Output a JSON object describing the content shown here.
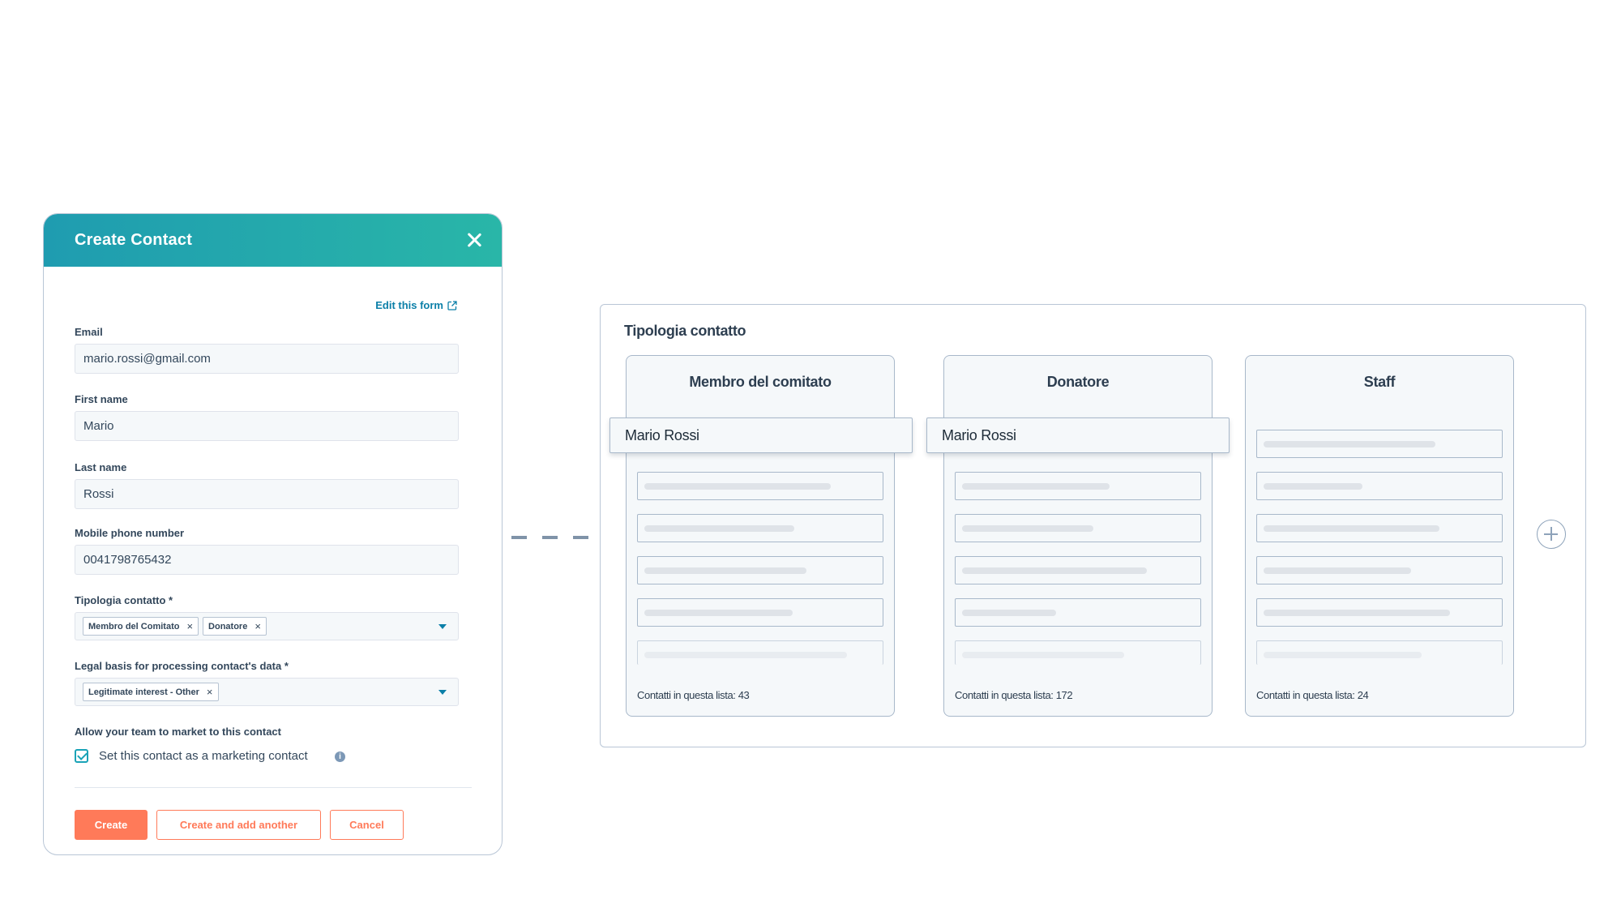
{
  "modal": {
    "title": "Create Contact",
    "edit_link": "Edit this form",
    "fields": {
      "email": {
        "label": "Email",
        "value": "mario.rossi@gmail.com"
      },
      "first_name": {
        "label": "First name",
        "value": "Mario"
      },
      "last_name": {
        "label": "Last name",
        "value": "Rossi"
      },
      "phone": {
        "label": "Mobile phone number",
        "value": "0041798765432"
      },
      "tipologia": {
        "label": "Tipologia contatto *",
        "tags": [
          "Membro del Comitato",
          "Donatore"
        ]
      },
      "legal": {
        "label": "Legal basis for processing contact's data *",
        "tags": [
          "Legitimate interest - Other"
        ]
      }
    },
    "marketing": {
      "label": "Allow your team to market to this contact",
      "checkbox_label": "Set this contact as a marketing contact",
      "checked": true
    },
    "buttons": {
      "create": "Create",
      "create_another": "Create and add another",
      "cancel": "Cancel"
    }
  },
  "pipeline": {
    "title": "Tipologia contatto",
    "columns": [
      {
        "name": "Membro del comitato",
        "footer": "Contatti in questa lista: 43",
        "dragged_card": "Mario Rossi"
      },
      {
        "name": "Donatore",
        "footer": "Contatti in questa lista: 172",
        "dragged_card": "Mario Rossi"
      },
      {
        "name": "Staff",
        "footer": "Contatti in questa lista: 24"
      }
    ]
  },
  "colors": {
    "header_start": "#1f9cb0",
    "header_end": "#29b6a8",
    "accent": "#ff7a59",
    "link": "#0b7fa8",
    "checkbox": "#1aa3b7",
    "border": "#a8b8ca"
  }
}
